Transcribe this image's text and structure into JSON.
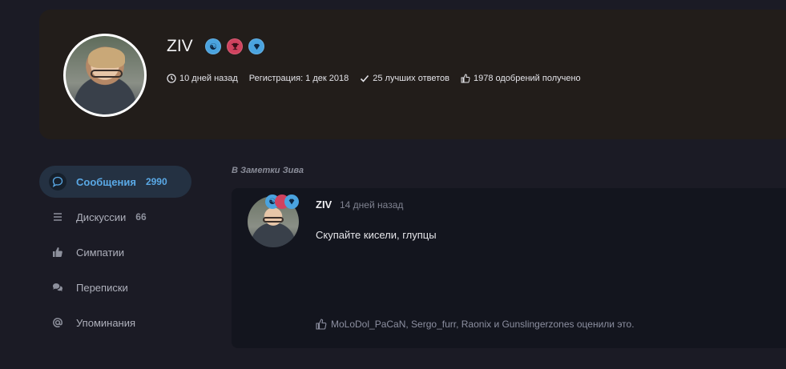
{
  "profile": {
    "name": "ZIV",
    "badges": [
      {
        "icon": "yin-yang-icon",
        "glyph": "☯",
        "color": "#4aa3df"
      },
      {
        "icon": "trophy-icon",
        "glyph": "🏆",
        "color": "#d0425e"
      },
      {
        "icon": "diamond-icon",
        "glyph": "◆",
        "color": "#4aa3df"
      }
    ],
    "stats": {
      "last_seen": "10 дней назад",
      "registration": "Регистрация: 1 дек 2018",
      "best_answers": "25 лучших ответов",
      "likes_received": "1978 одобрений получено"
    }
  },
  "sidebar": {
    "items": [
      {
        "label": "Сообщения",
        "count": "2990",
        "icon": "chat-bubble-icon",
        "active": true
      },
      {
        "label": "Дискуссии",
        "count": "66",
        "icon": "list-icon",
        "active": false
      },
      {
        "label": "Симпатии",
        "count": "",
        "icon": "thumbs-up-icon",
        "active": false
      },
      {
        "label": "Переписки",
        "count": "",
        "icon": "conversations-icon",
        "active": false
      },
      {
        "label": "Упоминания",
        "count": "",
        "icon": "at-icon",
        "active": false
      }
    ]
  },
  "feed": {
    "section_title": "В Заметки Зива",
    "post": {
      "author": "ZIV",
      "time": "14 дней назад",
      "text": "Скупайте кисели, глупцы",
      "likes": "MoLoDol_PaCaN, Sergo_furr, Raonix и Gunslingerzones оценили это."
    }
  },
  "colors": {
    "accent": "#5aa9e6",
    "header_bg": "#221d1a",
    "card_bg": "#13151e",
    "page_bg": "#1b1b25"
  }
}
